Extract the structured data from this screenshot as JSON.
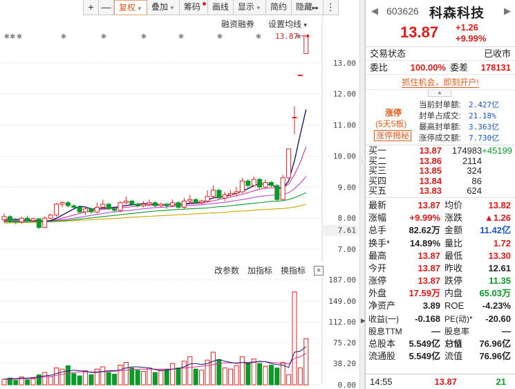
{
  "toolbar": {
    "plus": "+",
    "minus": "—",
    "items": [
      {
        "label": "复权",
        "has_dropdown": true,
        "active": true
      },
      {
        "label": "叠加",
        "has_dropdown": true
      },
      {
        "label": "筹码",
        "has_dot": true
      },
      {
        "label": "画线"
      },
      {
        "label": "显示",
        "has_dropdown": true
      },
      {
        "label": "简约"
      },
      {
        "label": "隐藏",
        "suffix": "▸▸"
      }
    ],
    "menu_icon": "⋮"
  },
  "chart_menu": {
    "margin": "融资融券",
    "settings": "设置均线",
    "settings_arrow": "▾"
  },
  "indicator_bar": {
    "modify": "改参数",
    "add": "加指标",
    "change": "换指标",
    "close": "×"
  },
  "price_tag": "13.87",
  "price_axis_ticks": [
    "13.00",
    "12.00",
    "11.00",
    "10.00",
    "9.00",
    "8.00",
    "7.61",
    "7.00"
  ],
  "volume_axis_ticks": [
    "187.00",
    "149.00",
    "112.00",
    "75.20",
    "38.20",
    "0.00"
  ],
  "chart_data": [
    {
      "type": "candlestick",
      "title": "",
      "ylim": [
        6.6,
        14.0
      ],
      "last_price": 13.87,
      "current_marker": 7.61,
      "colors": {
        "up": "#e02020",
        "down": "#0a9a2a",
        "ma5": "#1a1a6a",
        "ma10": "#d8329a",
        "ma20": "#b04ad0",
        "ma30": "#0a9a2a",
        "ma60": "#c8a800"
      },
      "candles": [
        {
          "o": 7.95,
          "c": 8.05,
          "h": 8.15,
          "l": 7.85
        },
        {
          "o": 8.05,
          "c": 7.9,
          "h": 8.1,
          "l": 7.85
        },
        {
          "o": 7.9,
          "c": 7.88,
          "h": 8.0,
          "l": 7.8
        },
        {
          "o": 7.88,
          "c": 8.0,
          "h": 8.05,
          "l": 7.82
        },
        {
          "o": 8.0,
          "c": 7.92,
          "h": 8.08,
          "l": 7.88
        },
        {
          "o": 7.92,
          "c": 7.98,
          "h": 8.02,
          "l": 7.86
        },
        {
          "o": 7.98,
          "c": 7.7,
          "h": 8.0,
          "l": 7.65
        },
        {
          "o": 7.7,
          "c": 8.0,
          "h": 8.06,
          "l": 7.68
        },
        {
          "o": 8.0,
          "c": 8.1,
          "h": 8.15,
          "l": 7.95
        },
        {
          "o": 8.1,
          "c": 8.45,
          "h": 8.5,
          "l": 8.05
        },
        {
          "o": 8.45,
          "c": 8.5,
          "h": 8.55,
          "l": 8.35
        },
        {
          "o": 8.5,
          "c": 8.4,
          "h": 8.55,
          "l": 8.35
        },
        {
          "o": 8.4,
          "c": 8.35,
          "h": 8.45,
          "l": 8.3
        },
        {
          "o": 8.35,
          "c": 8.2,
          "h": 8.4,
          "l": 8.15
        },
        {
          "o": 8.2,
          "c": 8.3,
          "h": 8.35,
          "l": 8.1
        },
        {
          "o": 8.3,
          "c": 8.2,
          "h": 8.35,
          "l": 8.15
        },
        {
          "o": 8.2,
          "c": 8.35,
          "h": 8.5,
          "l": 8.15
        },
        {
          "o": 8.35,
          "c": 8.45,
          "h": 8.6,
          "l": 8.3
        },
        {
          "o": 8.45,
          "c": 8.3,
          "h": 8.5,
          "l": 8.25
        },
        {
          "o": 8.3,
          "c": 8.25,
          "h": 8.35,
          "l": 8.2
        },
        {
          "o": 8.25,
          "c": 8.5,
          "h": 8.55,
          "l": 8.2
        },
        {
          "o": 8.5,
          "c": 8.55,
          "h": 8.7,
          "l": 8.45
        },
        {
          "o": 8.55,
          "c": 8.45,
          "h": 8.6,
          "l": 8.4
        },
        {
          "o": 8.45,
          "c": 8.4,
          "h": 8.5,
          "l": 8.35
        },
        {
          "o": 8.4,
          "c": 8.45,
          "h": 8.55,
          "l": 8.35
        },
        {
          "o": 8.45,
          "c": 8.5,
          "h": 8.6,
          "l": 8.4
        },
        {
          "o": 8.5,
          "c": 8.4,
          "h": 8.55,
          "l": 8.35
        },
        {
          "o": 8.4,
          "c": 8.45,
          "h": 8.5,
          "l": 8.35
        },
        {
          "o": 8.45,
          "c": 8.4,
          "h": 8.5,
          "l": 8.3
        },
        {
          "o": 8.4,
          "c": 8.5,
          "h": 8.6,
          "l": 8.35
        },
        {
          "o": 8.5,
          "c": 8.35,
          "h": 8.55,
          "l": 8.3
        },
        {
          "o": 8.35,
          "c": 8.55,
          "h": 8.65,
          "l": 8.3
        },
        {
          "o": 8.55,
          "c": 8.6,
          "h": 8.75,
          "l": 8.5
        },
        {
          "o": 8.6,
          "c": 8.5,
          "h": 8.65,
          "l": 8.45
        },
        {
          "o": 8.5,
          "c": 8.55,
          "h": 8.6,
          "l": 8.45
        },
        {
          "o": 8.55,
          "c": 8.7,
          "h": 8.9,
          "l": 8.5
        },
        {
          "o": 8.7,
          "c": 8.9,
          "h": 9.05,
          "l": 8.65
        },
        {
          "o": 8.9,
          "c": 8.65,
          "h": 8.95,
          "l": 8.6
        },
        {
          "o": 8.65,
          "c": 8.75,
          "h": 8.85,
          "l": 8.55
        },
        {
          "o": 8.75,
          "c": 8.8,
          "h": 8.9,
          "l": 8.7
        },
        {
          "o": 8.8,
          "c": 8.85,
          "h": 9.0,
          "l": 8.7
        },
        {
          "o": 8.85,
          "c": 9.2,
          "h": 9.3,
          "l": 8.8
        },
        {
          "o": 9.2,
          "c": 9.05,
          "h": 9.25,
          "l": 8.95
        },
        {
          "o": 9.05,
          "c": 9.25,
          "h": 9.35,
          "l": 9.0
        },
        {
          "o": 9.25,
          "c": 9.0,
          "h": 9.3,
          "l": 8.95
        },
        {
          "o": 9.0,
          "c": 9.15,
          "h": 9.25,
          "l": 8.95
        },
        {
          "o": 9.15,
          "c": 9.05,
          "h": 9.2,
          "l": 9.0
        },
        {
          "o": 9.05,
          "c": 8.6,
          "h": 9.1,
          "l": 8.55
        },
        {
          "o": 8.6,
          "c": 9.3,
          "h": 9.4,
          "l": 8.6
        },
        {
          "o": 9.3,
          "c": 10.23,
          "h": 10.23,
          "l": 9.3
        },
        {
          "o": 11.25,
          "c": 11.25,
          "h": 11.6,
          "l": 10.7
        },
        {
          "o": 12.61,
          "c": 12.61,
          "h": 12.61,
          "l": 12.61
        },
        {
          "o": 13.3,
          "c": 13.87,
          "h": 13.87,
          "l": 13.3
        }
      ],
      "ma_lines": {
        "ma5": [
          7.95,
          7.97,
          7.96,
          7.95,
          7.94,
          7.93,
          7.9,
          7.9,
          7.92,
          8.0,
          8.1,
          8.2,
          8.3,
          8.38,
          8.36,
          8.3,
          8.3,
          8.32,
          8.33,
          8.35,
          8.37,
          8.41,
          8.43,
          8.45,
          8.47,
          8.46,
          8.44,
          8.44,
          8.44,
          8.45,
          8.44,
          8.45,
          8.49,
          8.5,
          8.51,
          8.58,
          8.65,
          8.68,
          8.7,
          8.75,
          8.8,
          8.87,
          8.95,
          9.05,
          9.1,
          9.1,
          9.08,
          8.98,
          8.95,
          9.2,
          9.85,
          10.7,
          11.5
        ],
        "ma10": [
          7.92,
          7.93,
          7.93,
          7.94,
          7.94,
          7.93,
          7.92,
          7.91,
          7.92,
          7.96,
          8.0,
          8.05,
          8.1,
          8.15,
          8.2,
          8.24,
          8.26,
          8.28,
          8.3,
          8.32,
          8.33,
          8.35,
          8.37,
          8.39,
          8.41,
          8.42,
          8.42,
          8.43,
          8.44,
          8.45,
          8.45,
          8.45,
          8.46,
          8.47,
          8.48,
          8.52,
          8.56,
          8.6,
          8.64,
          8.68,
          8.72,
          8.77,
          8.82,
          8.88,
          8.93,
          8.96,
          8.98,
          8.98,
          8.98,
          9.1,
          9.4,
          9.8,
          10.3
        ],
        "ma20": [
          7.9,
          7.9,
          7.9,
          7.91,
          7.91,
          7.91,
          7.91,
          7.91,
          7.92,
          7.93,
          7.95,
          7.97,
          8.0,
          8.03,
          8.06,
          8.09,
          8.12,
          8.15,
          8.18,
          8.2,
          8.22,
          8.24,
          8.26,
          8.28,
          8.3,
          8.32,
          8.34,
          8.35,
          8.36,
          8.38,
          8.39,
          8.4,
          8.41,
          8.42,
          8.43,
          8.45,
          8.47,
          8.49,
          8.51,
          8.54,
          8.57,
          8.6,
          8.63,
          8.67,
          8.7,
          8.72,
          8.74,
          8.75,
          8.76,
          8.82,
          8.95,
          9.12,
          9.35
        ],
        "ma30": [
          7.88,
          7.88,
          7.88,
          7.88,
          7.89,
          7.89,
          7.89,
          7.9,
          7.9,
          7.91,
          7.92,
          7.93,
          7.95,
          7.97,
          7.99,
          8.01,
          8.03,
          8.05,
          8.07,
          8.09,
          8.11,
          8.13,
          8.15,
          8.17,
          8.19,
          8.21,
          8.23,
          8.24,
          8.25,
          8.27,
          8.28,
          8.29,
          8.3,
          8.31,
          8.32,
          8.33,
          8.35,
          8.37,
          8.38,
          8.4,
          8.42,
          8.44,
          8.46,
          8.48,
          8.5,
          8.52,
          8.54,
          8.55,
          8.56,
          8.6,
          8.66,
          8.74,
          8.82
        ],
        "ma60": [
          7.84,
          7.85,
          7.85,
          7.86,
          7.86,
          7.87,
          7.87,
          7.88,
          7.88,
          7.89,
          7.9,
          7.91,
          7.92,
          7.93,
          7.94,
          7.95,
          7.96,
          7.97,
          7.98,
          7.99,
          8.0,
          8.02,
          8.03,
          8.04,
          8.05,
          8.06,
          8.07,
          8.08,
          8.09,
          8.1,
          8.11,
          8.12,
          8.13,
          8.14,
          8.15,
          8.16,
          8.17,
          8.18,
          8.19,
          8.21,
          8.22,
          8.23,
          8.24,
          8.26,
          8.27,
          8.28,
          8.29,
          8.3,
          8.31,
          8.33,
          8.36,
          8.4,
          8.45
        ]
      }
    },
    {
      "type": "bar",
      "title": "",
      "ylim": [
        0,
        187
      ],
      "values": [
        10,
        12,
        8,
        14,
        9,
        11,
        18,
        22,
        15,
        30,
        28,
        34,
        20,
        16,
        25,
        18,
        28,
        32,
        22,
        19,
        35,
        40,
        30,
        26,
        24,
        30,
        22,
        25,
        28,
        38,
        30,
        42,
        50,
        28,
        26,
        44,
        58,
        45,
        30,
        28,
        34,
        50,
        40,
        46,
        38,
        33,
        35,
        30,
        40,
        18,
        165,
        30,
        82
      ],
      "up": [
        true,
        false,
        false,
        true,
        false,
        true,
        false,
        true,
        true,
        true,
        true,
        false,
        false,
        false,
        true,
        false,
        true,
        true,
        false,
        false,
        true,
        true,
        false,
        false,
        true,
        true,
        false,
        true,
        false,
        true,
        false,
        true,
        true,
        false,
        true,
        true,
        true,
        false,
        true,
        true,
        true,
        true,
        false,
        true,
        false,
        true,
        false,
        false,
        true,
        true,
        true,
        true,
        true
      ],
      "ma5": [
        10,
        11,
        11,
        12,
        12,
        13,
        14,
        16,
        17,
        20,
        23,
        25,
        26,
        25,
        24,
        22,
        22,
        24,
        25,
        25,
        27,
        30,
        32,
        32,
        31,
        30,
        27,
        26,
        26,
        28,
        29,
        32,
        37,
        38,
        36,
        38,
        42,
        45,
        42,
        40,
        38,
        40,
        38,
        40,
        42,
        41,
        38,
        36,
        35,
        31,
        58,
        60,
        68
      ],
      "ma10": [
        10,
        10,
        10,
        11,
        11,
        12,
        13,
        14,
        15,
        17,
        19,
        21,
        22,
        23,
        23,
        23,
        23,
        23,
        24,
        24,
        25,
        26,
        27,
        28,
        28,
        28,
        28,
        28,
        28,
        28,
        29,
        30,
        31,
        32,
        33,
        34,
        36,
        38,
        39,
        39,
        39,
        40,
        40,
        41,
        41,
        41,
        40,
        39,
        38,
        37,
        47,
        50,
        56
      ]
    }
  ],
  "quote": {
    "nav_left": "◀",
    "nav_right": "▶",
    "code": "603626",
    "name": "科森科技",
    "price": "13.87",
    "change": "+1.26",
    "change_pct": "+9.99%",
    "status_label": "交易状态",
    "status_value": "已收市",
    "wei_ratio_label": "委比",
    "wei_ratio_value": "100.00%",
    "wei_diff_label": "委差",
    "wei_diff_value": "178131",
    "promo": "抓住机会，即刻开户!",
    "limit": {
      "tab": "▲",
      "title": "涨停",
      "streak": "(5天5板)",
      "reveal": "涨停揭秘",
      "lines": [
        {
          "label": "当前封单额:",
          "value": "2.427亿"
        },
        {
          "label": "封单占成交:",
          "value": "21.18%"
        },
        {
          "label": "最高封单额:",
          "value": "3.363亿"
        },
        {
          "label": "涨停成交额:",
          "value": "7.730亿"
        }
      ]
    },
    "order_book": [
      {
        "label": "买一",
        "price": "13.87",
        "vol": "174983",
        "extra": "+45199"
      },
      {
        "label": "买二",
        "price": "13.86",
        "vol": "2114"
      },
      {
        "label": "买三",
        "price": "13.85",
        "vol": "324"
      },
      {
        "label": "买四",
        "price": "13.84",
        "vol": "86"
      },
      {
        "label": "买五",
        "price": "13.83",
        "vol": "624"
      }
    ],
    "stats": [
      {
        "k1": "最新",
        "v1": "13.87",
        "c1": "red",
        "k2": "均价",
        "v2": "13.82",
        "c2": "red"
      },
      {
        "k1": "涨幅",
        "v1": "+9.99%",
        "c1": "red",
        "k2": "涨跌",
        "v2": "▲1.26",
        "c2": "red"
      },
      {
        "k1": "总手",
        "v1": "82.62万",
        "c1": "",
        "k2": "金额",
        "v2": "11.42亿",
        "c2": "blue"
      },
      {
        "k1": "换手*",
        "v1": "14.89%",
        "c1": "",
        "k2": "量比",
        "v2": "1.72",
        "c2": "red"
      },
      {
        "k1": "最高",
        "v1": "13.87",
        "c1": "red",
        "k2": "最低",
        "v2": "13.30",
        "c2": "red"
      },
      {
        "k1": "今开",
        "v1": "13.87",
        "c1": "red",
        "k2": "昨收",
        "v2": "12.61",
        "c2": ""
      },
      {
        "k1": "涨停",
        "v1": "13.87",
        "c1": "red",
        "k2": "跌停",
        "v2": "11.35",
        "c2": "green"
      },
      {
        "k1": "外盘",
        "v1": "17.59万",
        "c1": "red",
        "k2": "内盘",
        "v2": "65.03万",
        "c2": "green"
      },
      {
        "k1": "净资产",
        "v1": "3.89",
        "c1": "",
        "k2": "ROE",
        "v2": "-4.23%",
        "c2": ""
      },
      {
        "k1": "收益(一)",
        "v1": "-0.168",
        "c1": "",
        "k2": "PE(动)*",
        "v2": "-20.60",
        "c2": ""
      },
      {
        "k1": "股息TTM",
        "v1": "—",
        "c1": "",
        "k2": "股息率TTM",
        "v2": "—",
        "c2": ""
      },
      {
        "k1": "总股本",
        "v1": "5.549亿",
        "c1": "",
        "k2": "总值",
        "v2": "76.96亿",
        "c2": ""
      },
      {
        "k1": "流通股",
        "v1": "5.549亿",
        "c1": "",
        "k2": "流值",
        "v2": "76.96亿",
        "c2": ""
      }
    ],
    "last_tick": {
      "time": "14:55",
      "price": "13.87",
      "vol": "21"
    }
  }
}
